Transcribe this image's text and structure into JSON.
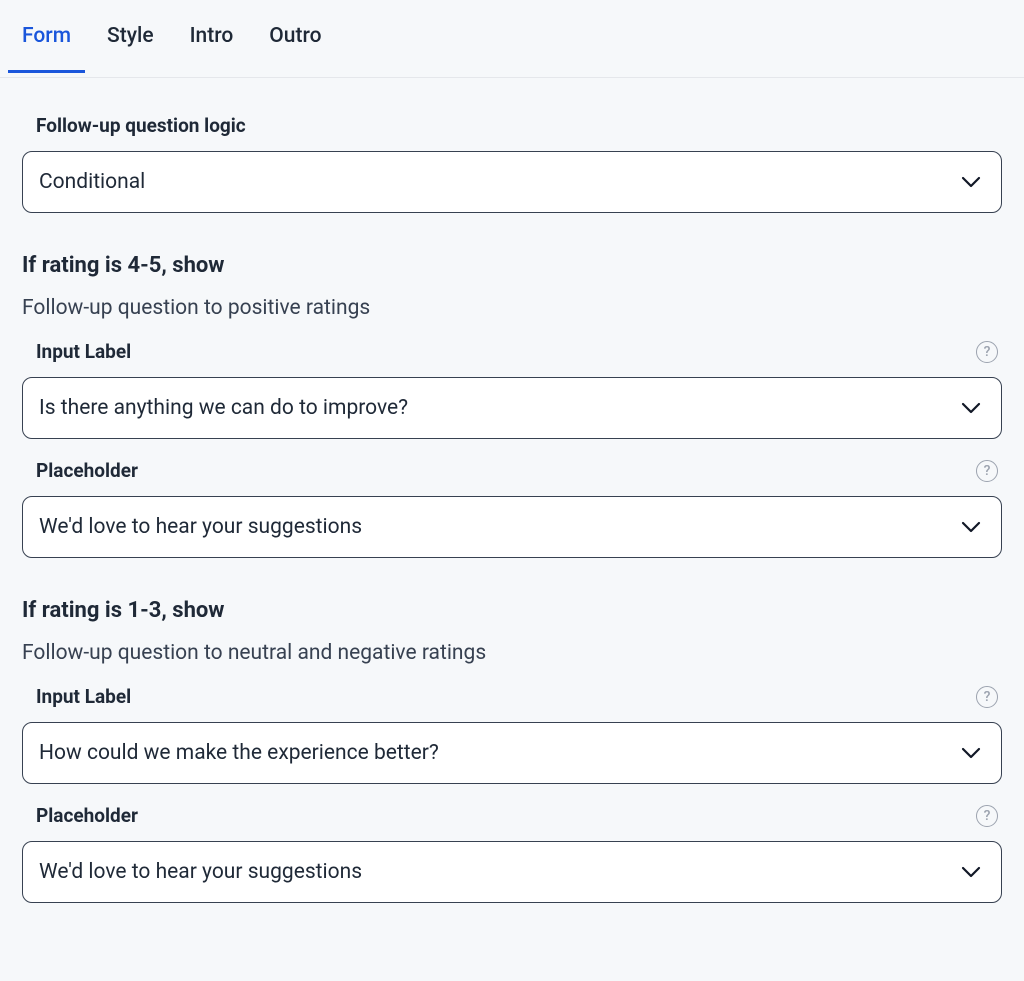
{
  "tabs": {
    "form": "Form",
    "style": "Style",
    "intro": "Intro",
    "outro": "Outro"
  },
  "logic": {
    "label": "Follow-up question logic",
    "value": "Conditional"
  },
  "positive": {
    "heading": "If rating is 4-5, show",
    "subtext": "Follow-up question to positive ratings",
    "input_label_label": "Input Label",
    "input_label_value": "Is there anything we can do to improve?",
    "placeholder_label": "Placeholder",
    "placeholder_value": "We'd love to hear your suggestions"
  },
  "negative": {
    "heading": "If rating is 1-3, show",
    "subtext": "Follow-up question to neutral and negative ratings",
    "input_label_label": "Input Label",
    "input_label_value": "How could we make the experience better?",
    "placeholder_label": "Placeholder",
    "placeholder_value": "We'd love to hear your suggestions"
  },
  "help_glyph": "?"
}
